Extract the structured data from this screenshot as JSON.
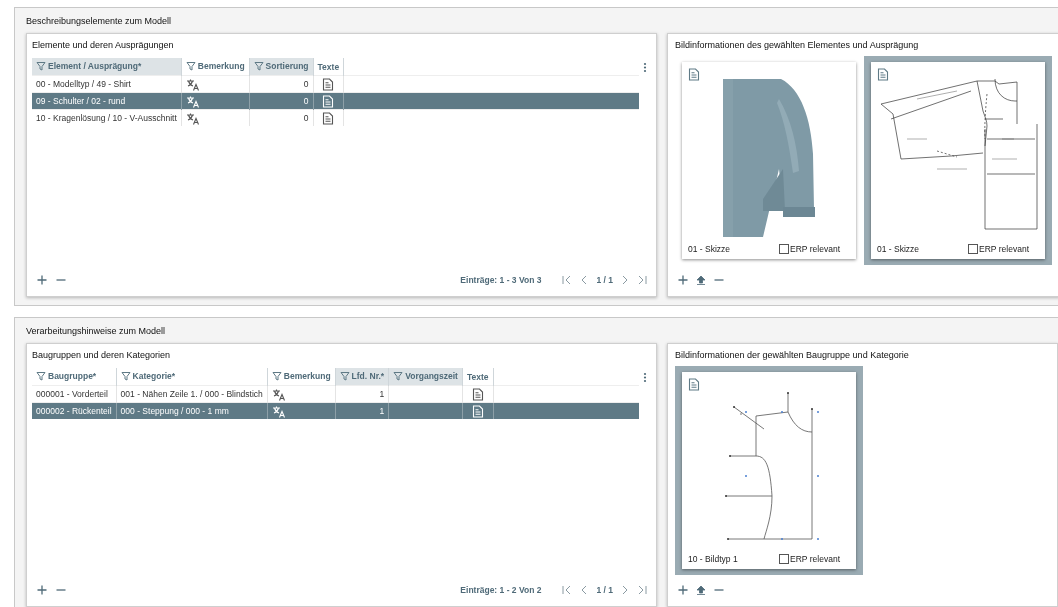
{
  "sections": [
    {
      "title": "Beschreibungselemente zum Modell",
      "table": {
        "title": "Elemente und deren Ausprägungen",
        "columns": [
          {
            "label": "Element / Ausprägung*",
            "kind": "text",
            "filter": true,
            "highlighted": true
          },
          {
            "label": "Bemerkung",
            "kind": "translate",
            "filter": true,
            "highlighted": false
          },
          {
            "label": "Sortierung",
            "kind": "number",
            "filter": true,
            "highlighted": true
          },
          {
            "label": "Texte",
            "kind": "document",
            "filter": false,
            "highlighted": false
          }
        ],
        "rows": [
          {
            "values": [
              "00 - Modelltyp / 49 - Shirt",
              "0"
            ],
            "selected": false
          },
          {
            "values": [
              "09 - Schulter / 02 - rund",
              "0"
            ],
            "selected": true
          },
          {
            "values": [
              "10 - Kragenlösung / 10 - V-Ausschnitt",
              "0"
            ],
            "selected": false
          }
        ],
        "entries": "Einträge: 1 - 3 Von 3",
        "page": "1 / 1"
      },
      "images": {
        "title": "Bildinformationen des gewählten Elementes und Ausprägung",
        "items": [
          {
            "caption": "01 - Skizze",
            "erp_label": "ERP relevant",
            "erp_checked": false,
            "selected": false
          },
          {
            "kind": "pattern",
            "caption": "01 - Skizze",
            "erp_label": "ERP relevant",
            "erp_checked": false,
            "selected": true
          }
        ]
      }
    },
    {
      "title": "Verarbeitungshinweise zum Modell",
      "table": {
        "title": "Baugruppen und deren Kategorien",
        "columns": [
          {
            "label": "Baugruppe*",
            "kind": "text",
            "filter": true,
            "highlighted": false
          },
          {
            "label": "Kategorie*",
            "kind": "text",
            "filter": true,
            "highlighted": false
          },
          {
            "label": "Bemerkung",
            "kind": "translate",
            "filter": true,
            "highlighted": false
          },
          {
            "label": "Lfd. Nr.*",
            "kind": "number",
            "filter": true,
            "highlighted": true
          },
          {
            "label": "Vorgangszeit",
            "kind": "text",
            "filter": true,
            "highlighted": true
          },
          {
            "label": "Texte",
            "kind": "document",
            "filter": false,
            "highlighted": false
          }
        ],
        "rows": [
          {
            "values": [
              "000001 - Vorderteil",
              "001 - Nähen Zeile 1. / 000 - Blindstich",
              "1"
            ],
            "selected": false
          },
          {
            "values": [
              "000002 - Rückenteil",
              "000 - Steppung / 000 - 1 mm",
              "1"
            ],
            "selected": true
          }
        ],
        "entries": "Einträge: 1 - 2 Von 2",
        "page": "1 / 1"
      },
      "images": {
        "title": "Bildinformationen der gewählten Baugruppe und Kategorie",
        "items": [
          {
            "kind": "sketch",
            "caption": "10 - Bildtyp 1",
            "erp_label": "ERP relevant",
            "erp_checked": false,
            "selected": true
          }
        ]
      }
    }
  ]
}
